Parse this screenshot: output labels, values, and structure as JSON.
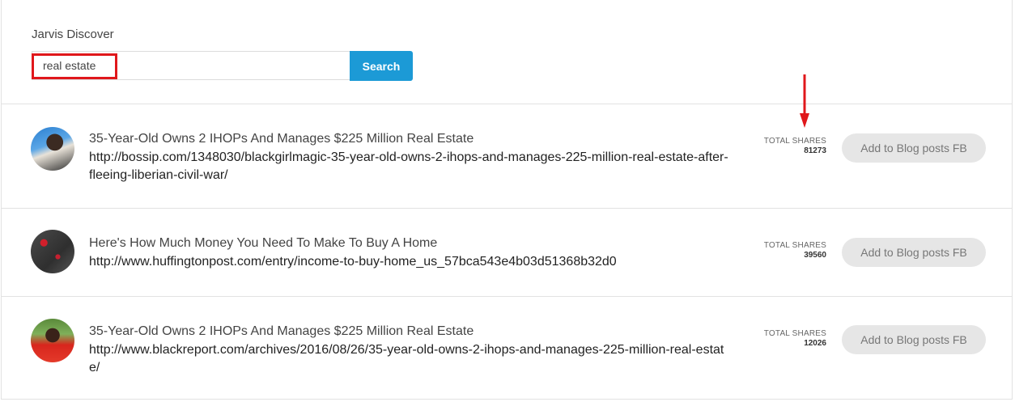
{
  "app": {
    "title": "Jarvis Discover"
  },
  "search": {
    "value": "real estate",
    "button_label": "Search"
  },
  "colors": {
    "accent": "#1c9ad6",
    "highlight": "#e0171b",
    "button_gray": "#e6e6e6"
  },
  "results": [
    {
      "title": "35-Year-Old Owns 2 IHOPs And Manages $225 Million Real Estate",
      "url": "http://bossip.com/1348030/blackgirlmagic-35-year-old-owns-2-ihops-and-manages-225-million-real-estate-after-fleeing-liberian-civil-war/",
      "shares_label": "TOTAL SHARES",
      "shares": "81273",
      "action_label": "Add to Blog posts FB"
    },
    {
      "title": "Here's How Much Money You Need To Make To Buy A Home",
      "url": "http://www.huffingtonpost.com/entry/income-to-buy-home_us_57bca543e4b03d51368b32d0",
      "shares_label": "TOTAL SHARES",
      "shares": "39560",
      "action_label": "Add to Blog posts FB"
    },
    {
      "title": "35-Year-Old Owns 2 IHOPs And Manages $225 Million Real Estate",
      "url": "http://www.blackreport.com/archives/2016/08/26/35-year-old-owns-2-ihops-and-manages-225-million-real-estate/",
      "shares_label": "TOTAL SHARES",
      "shares": "12026",
      "action_label": "Add to Blog posts FB"
    }
  ]
}
